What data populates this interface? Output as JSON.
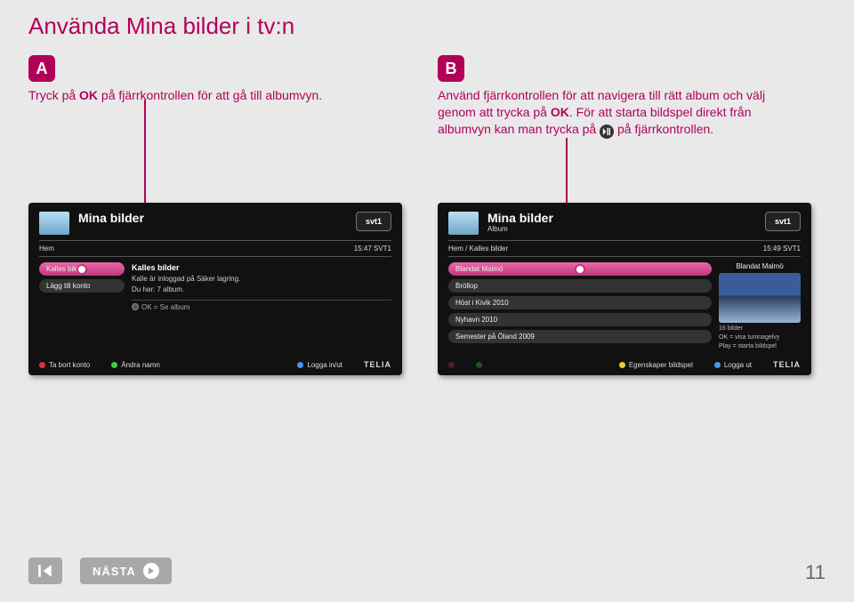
{
  "page": {
    "title": "Använda Mina bilder i tv:n",
    "page_number": "11"
  },
  "steps": {
    "A": {
      "badge": "A",
      "text_before": "Tryck på ",
      "text_bold": "OK",
      "text_after": " på fjärrkontrollen för att gå till albumvyn."
    },
    "B": {
      "badge": "B",
      "line1_before": "Använd fjärrkontrollen för att navigera till rätt album och välj genom att trycka på ",
      "line1_bold": "OK",
      "line1_after": ". För att starta bildspel direkt från albumvyn kan man trycka på ",
      "line1_tail": " på fjärrkontrollen."
    }
  },
  "tvA": {
    "title": "Mina bilder",
    "channel": "svt1",
    "breadcrumb_left": "Hem",
    "breadcrumb_right": "15:47 SVT1",
    "left_items": [
      "Kalles bilder",
      "Lägg till konto"
    ],
    "mid_title": "Kalles bilder",
    "mid_line1": "Kalle är inloggad på Säker lagring.",
    "mid_line2": "Du har: 7 album.",
    "mid_hint": "OK = Se album",
    "footer": {
      "red": "Ta bort konto",
      "green": "Ändra namn",
      "blue": "Logga in/ut",
      "logo": "TELIA"
    }
  },
  "tvB": {
    "title": "Mina bilder",
    "subtitle": "Album",
    "channel": "svt1",
    "breadcrumb_left": "Hem / Kalles bilder",
    "breadcrumb_right": "15:49 SVT1",
    "albums": [
      "Blandat Malmö",
      "Bröllop",
      "Höst i Kivik 2010",
      "Nyhavn 2010",
      "Semester på Öland 2009"
    ],
    "preview_title": "Blandat Malmö",
    "preview_line1": "16 bilder",
    "preview_line2": "OK = visa tumnagelvy",
    "preview_line3": "Play = starta bildspel",
    "footer": {
      "yellow": "Egenskaper bildspel",
      "blue": "Logga ut",
      "logo": "TELIA"
    }
  },
  "nav": {
    "next": "NÄSTA"
  }
}
